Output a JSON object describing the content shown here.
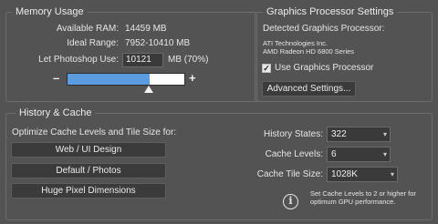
{
  "memory": {
    "title": "Memory Usage",
    "available_label": "Available RAM:",
    "available_value": "14459 MB",
    "ideal_label": "Ideal Range:",
    "ideal_value": "7952-10410 MB",
    "let_use_label": "Let Photoshop Use:",
    "let_use_value": "10121",
    "let_use_unit": "MB (70%)",
    "slider_minus": "–",
    "slider_plus": "+",
    "slider_fraction": 0.7
  },
  "gpu": {
    "title": "Graphics Processor Settings",
    "detected_label": "Detected Graphics Processor:",
    "vendor": "ATI Technologies Inc.",
    "model": "AMD Radeon HD 6800 Series",
    "use_gpu_label": "Use Graphics Processor",
    "use_gpu_checked": "✓",
    "advanced_button": "Advanced Settings..."
  },
  "history": {
    "title": "History & Cache",
    "optimize_label": "Optimize Cache Levels and Tile Size for:",
    "buttons": [
      "Web / UI Design",
      "Default / Photos",
      "Huge Pixel Dimensions"
    ],
    "history_states_label": "History States:",
    "history_states_value": "322",
    "cache_levels_label": "Cache Levels:",
    "cache_levels_value": "6",
    "tile_size_label": "Cache Tile Size:",
    "tile_size_value": "1028K",
    "info_line1": "Set Cache Levels to 2 or higher for",
    "info_line2": "optimum GPU performance.",
    "info_icon": "i"
  },
  "colors": {
    "slider_fill": "#5b9be0",
    "slider_empty": "#ffffff"
  }
}
